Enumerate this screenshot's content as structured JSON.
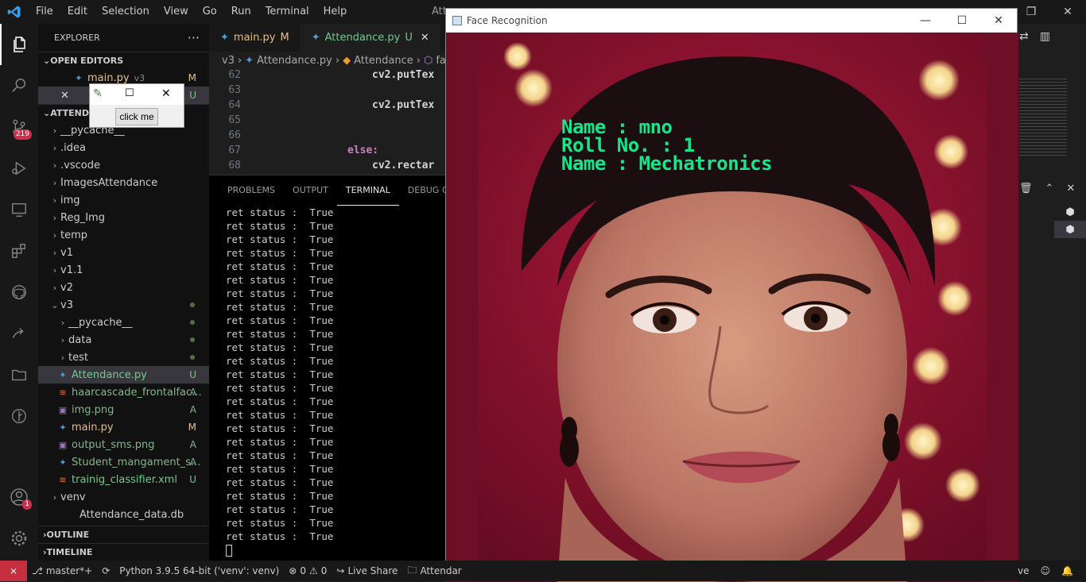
{
  "menubar": {
    "items": [
      "File",
      "Edit",
      "Selection",
      "View",
      "Go",
      "Run",
      "Terminal",
      "Help"
    ],
    "title": "Atte"
  },
  "activity": {
    "scm_badge": "219",
    "account_badge": "1"
  },
  "explorer": {
    "header": "EXPLORER",
    "open_editors_label": "OPEN EDITORS",
    "open_editor_1": {
      "name": "main.py",
      "folder": "v3",
      "status": "M"
    },
    "open_editor_2_status": "U",
    "root_label": "ATTEND",
    "tree": [
      {
        "label": "__pycache__",
        "type": "folder",
        "depth": 1
      },
      {
        "label": ".idea",
        "type": "folder",
        "depth": 1
      },
      {
        "label": ".vscode",
        "type": "folder",
        "depth": 1
      },
      {
        "label": "ImagesAttendance",
        "type": "folder",
        "depth": 1
      },
      {
        "label": "img",
        "type": "folder",
        "depth": 1
      },
      {
        "label": "Reg_Img",
        "type": "folder",
        "depth": 1
      },
      {
        "label": "temp",
        "type": "folder",
        "depth": 1
      },
      {
        "label": "v1",
        "type": "folder",
        "depth": 1
      },
      {
        "label": "v1.1",
        "type": "folder",
        "depth": 1
      },
      {
        "label": "v2",
        "type": "folder",
        "depth": 1
      },
      {
        "label": "v3",
        "type": "open-folder",
        "depth": 1
      },
      {
        "label": "__pycache__",
        "type": "folder",
        "depth": 2
      },
      {
        "label": "data",
        "type": "folder",
        "depth": 2
      },
      {
        "label": "test",
        "type": "folder",
        "depth": 2
      },
      {
        "label": "Attendance.py",
        "type": "py",
        "depth": 2,
        "status": "U",
        "selected": true
      },
      {
        "label": "haarcascade_frontalfac...",
        "type": "xml",
        "depth": 2,
        "status": "A"
      },
      {
        "label": "img.png",
        "type": "img",
        "depth": 2,
        "status": "A"
      },
      {
        "label": "main.py",
        "type": "py",
        "depth": 2,
        "status": "M"
      },
      {
        "label": "output_sms.png",
        "type": "img",
        "depth": 2,
        "status": "A"
      },
      {
        "label": "Student_mangament_s...",
        "type": "py",
        "depth": 2,
        "status": "A"
      },
      {
        "label": "trainig_classifier.xml",
        "type": "xml",
        "depth": 2,
        "status": "U"
      },
      {
        "label": "venv",
        "type": "folder",
        "depth": 1
      },
      {
        "label": "Attendance_data.db",
        "type": "file",
        "depth": 1
      }
    ],
    "outline_label": "OUTLINE",
    "timeline_label": "TIMELINE"
  },
  "tabs": [
    {
      "label": "main.py",
      "status": "M"
    },
    {
      "label": "Attendance.py",
      "status": "U"
    }
  ],
  "breadcrumb": [
    "v3",
    "Attendance.py",
    "Attendance",
    "fa"
  ],
  "code": [
    {
      "n": "62",
      "text": "cv2.putTex",
      "indent": 5
    },
    {
      "n": "63",
      "text": "",
      "indent": 0
    },
    {
      "n": "64",
      "text": "cv2.putTex",
      "indent": 5
    },
    {
      "n": "65",
      "text": "",
      "indent": 0
    },
    {
      "n": "66",
      "text": "",
      "indent": 0
    },
    {
      "n": "67",
      "text": "else:",
      "indent": 4
    },
    {
      "n": "68",
      "text": "cv2.rectar",
      "indent": 5
    }
  ],
  "panel": {
    "tabs": [
      "PROBLEMS",
      "OUTPUT",
      "TERMINAL",
      "DEBUG CON"
    ],
    "active_tab": "TERMINAL",
    "line": "ret status :  True",
    "line_count": 25
  },
  "tk_window": {
    "button_label": "click me"
  },
  "cv_window": {
    "title": "Face Recognition",
    "overlay_lines": [
      "Name : mno",
      "Roll No. : 1",
      "Name : Mechatronics"
    ],
    "overlay_color": "#14e68c"
  },
  "statusbar": {
    "branch": "master*+",
    "python": "Python 3.9.5 64-bit ('venv': venv)",
    "errors": "0",
    "warnings": "0",
    "liveshare": "Live Share",
    "folder": "Attendar",
    "right_text": "ve"
  }
}
